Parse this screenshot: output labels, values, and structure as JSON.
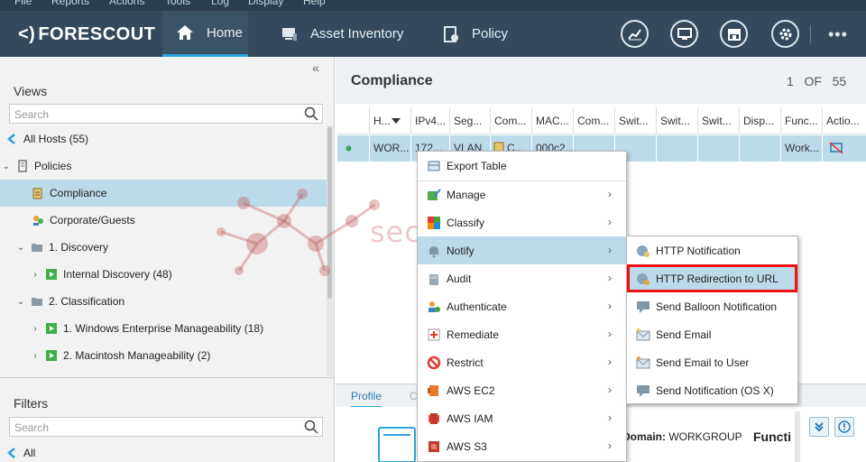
{
  "menubar": [
    "File",
    "Reports",
    "Actions",
    "Tools",
    "Log",
    "Display",
    "Help"
  ],
  "brand": {
    "name": "FORESCOUT",
    "mark": "<)"
  },
  "nav": {
    "tabs": [
      "Home",
      "Asset Inventory",
      "Policy"
    ],
    "active": "Home"
  },
  "topicons": [
    "dashboard-icon",
    "console-icon",
    "store-icon",
    "settings-icon"
  ],
  "more": "•••",
  "views": {
    "title": "Views",
    "collapse": "«",
    "search_placeholder": "Search",
    "tree": [
      {
        "label": "All Hosts (55)",
        "level": 0,
        "expander": "",
        "icon": "all-hosts-icon"
      },
      {
        "label": "Policies",
        "level": 0,
        "expander": "⌄",
        "icon": "policies-icon"
      },
      {
        "label": "Compliance",
        "level": 1,
        "expander": "",
        "icon": "compliance-icon",
        "selected": true
      },
      {
        "label": "Corporate/Guests",
        "level": 1,
        "expander": "",
        "icon": "corporate-guests-icon"
      },
      {
        "label": "1. Discovery",
        "level": 1,
        "expander": "⌄",
        "icon": "folder-icon"
      },
      {
        "label": "Internal Discovery (48)",
        "level": 2,
        "expander": "›",
        "icon": "policy-run-icon"
      },
      {
        "label": "2. Classification",
        "level": 1,
        "expander": "⌄",
        "icon": "folder-icon"
      },
      {
        "label": "1. Windows Enterprise Manageability (18)",
        "level": 2,
        "expander": "›",
        "icon": "policy-run-icon"
      },
      {
        "label": "2. Macintosh Manageability (2)",
        "level": 2,
        "expander": "›",
        "icon": "policy-run-icon"
      }
    ]
  },
  "filters": {
    "title": "Filters",
    "search_placeholder": "Search",
    "first_item": "All"
  },
  "main": {
    "title": "Compliance",
    "pager": {
      "current": "1",
      "of": "OF",
      "total": "55"
    },
    "columns": [
      "H...",
      "IPv4...",
      "Seg...",
      "Com...",
      "MAC...",
      "Com...",
      "Swit...",
      "Swit...",
      "Swit...",
      "Disp...",
      "Func...",
      "Actio..."
    ],
    "row": [
      "WOR...",
      "172...",
      "VLAN",
      "C...",
      "000c2...",
      "",
      "",
      "",
      "",
      "",
      "Work...",
      ""
    ],
    "bottom_tabs": [
      "Profile",
      "C"
    ],
    "detail": {
      "domain_label": "Domain:",
      "domain_value": "WORKGROUP",
      "func_label": "Functi"
    }
  },
  "context_menu": {
    "items": [
      {
        "label": "Export Table",
        "icon": "export-table-icon",
        "submenu": false
      },
      {
        "label": "Manage",
        "icon": "manage-icon",
        "submenu": true
      },
      {
        "label": "Classify",
        "icon": "classify-icon",
        "submenu": true
      },
      {
        "label": "Notify",
        "icon": "notify-icon",
        "submenu": true,
        "highlighted": true
      },
      {
        "label": "Audit",
        "icon": "audit-icon",
        "submenu": true
      },
      {
        "label": "Authenticate",
        "icon": "authenticate-icon",
        "submenu": true
      },
      {
        "label": "Remediate",
        "icon": "remediate-icon",
        "submenu": true
      },
      {
        "label": "Restrict",
        "icon": "restrict-icon",
        "submenu": true
      },
      {
        "label": "AWS EC2",
        "icon": "aws-ec2-icon",
        "submenu": true
      },
      {
        "label": "AWS IAM",
        "icon": "aws-iam-icon",
        "submenu": true
      },
      {
        "label": "AWS S3",
        "icon": "aws-s3-icon",
        "submenu": true
      }
    ]
  },
  "notify_submenu": {
    "items": [
      {
        "label": "HTTP Notification",
        "icon": "http-notification-icon"
      },
      {
        "label": "HTTP Redirection to URL",
        "icon": "http-redirect-icon",
        "highlighted": true
      },
      {
        "label": "Send Balloon Notification",
        "icon": "balloon-icon"
      },
      {
        "label": "Send Email",
        "icon": "email-icon"
      },
      {
        "label": "Send Email to User",
        "icon": "email-user-icon"
      },
      {
        "label": "Send Notification (OS X)",
        "icon": "osx-notification-icon"
      }
    ]
  },
  "watermark": "securityzone.vn",
  "colors": {
    "nav_bg": "#34495e",
    "accent": "#2ea3dd",
    "selection": "#bcdbea",
    "highlight_border": "#ee1111"
  }
}
